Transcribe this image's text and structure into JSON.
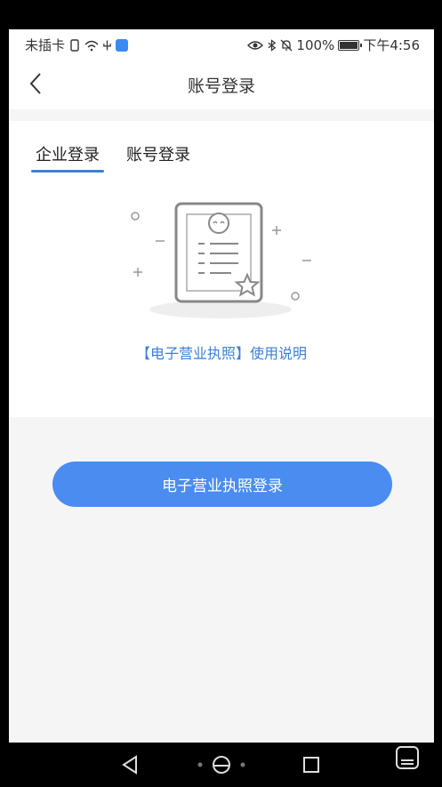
{
  "status_bar": {
    "carrier": "未插卡",
    "battery": "100%",
    "time": "下午4:56",
    "battery_level": 1.0
  },
  "nav": {
    "title": "账号登录",
    "back_icon": "chevron-left-icon"
  },
  "tabs": [
    {
      "label": "企业登录",
      "active": true
    },
    {
      "label": "账号登录",
      "active": false
    }
  ],
  "illustration": {
    "icon": "license-document-icon"
  },
  "help_link": "【电子营业执照】使用说明",
  "login_button": "电子营业执照登录",
  "colors": {
    "accent": "#4a8cef",
    "link": "#3b7fd6",
    "background": "#f5f5f5"
  }
}
